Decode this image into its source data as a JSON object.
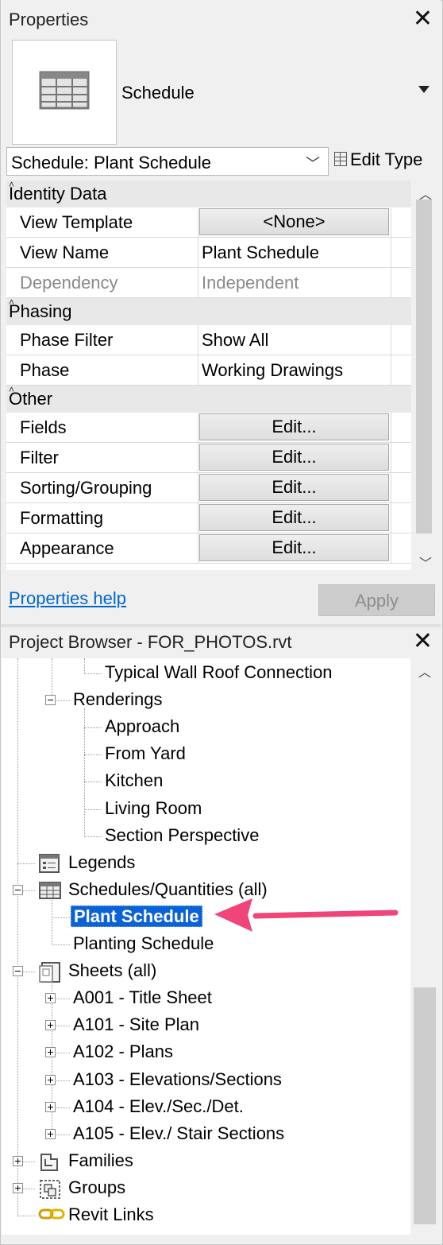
{
  "properties": {
    "title": "Properties",
    "type_name": "Schedule",
    "selector_value": "Schedule: Plant Schedule",
    "edit_type_label": "Edit Type",
    "categories": [
      {
        "name": "Identity Data",
        "rows": [
          {
            "label": "View Template",
            "value": "<None>",
            "kind": "button"
          },
          {
            "label": "View Name",
            "value": "Plant Schedule",
            "kind": "text"
          },
          {
            "label": "Dependency",
            "value": "Independent",
            "kind": "disabled"
          }
        ]
      },
      {
        "name": "Phasing",
        "rows": [
          {
            "label": "Phase Filter",
            "value": "Show All",
            "kind": "text"
          },
          {
            "label": "Phase",
            "value": "Working Drawings",
            "kind": "text"
          }
        ]
      },
      {
        "name": "Other",
        "rows": [
          {
            "label": "Fields",
            "value": "Edit...",
            "kind": "button"
          },
          {
            "label": "Filter",
            "value": "Edit...",
            "kind": "button"
          },
          {
            "label": "Sorting/Grouping",
            "value": "Edit...",
            "kind": "button"
          },
          {
            "label": "Formatting",
            "value": "Edit...",
            "kind": "button"
          },
          {
            "label": "Appearance",
            "value": "Edit...",
            "kind": "button"
          }
        ]
      }
    ],
    "help_link": "Properties help",
    "apply_label": "Apply"
  },
  "browser": {
    "title": "Project Browser - FOR_PHOTOS.rvt",
    "nodes": [
      {
        "label": "Typical Wall Roof Connection",
        "level": 3,
        "toggle": "",
        "icon": ""
      },
      {
        "label": "Renderings",
        "level": 2,
        "toggle": "minus",
        "icon": ""
      },
      {
        "label": "Approach",
        "level": 3,
        "toggle": "",
        "icon": ""
      },
      {
        "label": "From Yard",
        "level": 3,
        "toggle": "",
        "icon": ""
      },
      {
        "label": "Kitchen",
        "level": 3,
        "toggle": "",
        "icon": ""
      },
      {
        "label": "Living Room",
        "level": 3,
        "toggle": "",
        "icon": ""
      },
      {
        "label": "Section Perspective",
        "level": 3,
        "toggle": "",
        "icon": ""
      },
      {
        "label": "Legends",
        "level": 1,
        "toggle": "",
        "icon": "legend-icon"
      },
      {
        "label": "Schedules/Quantities (all)",
        "level": 1,
        "toggle": "minus",
        "icon": "schedule-icon"
      },
      {
        "label": "Plant Schedule",
        "level": 2,
        "toggle": "",
        "icon": "",
        "selected": true
      },
      {
        "label": "Planting Schedule",
        "level": 2,
        "toggle": "",
        "icon": ""
      },
      {
        "label": "Sheets (all)",
        "level": 1,
        "toggle": "minus",
        "icon": "sheets-icon"
      },
      {
        "label": "A001 - Title Sheet",
        "level": 2,
        "toggle": "plus",
        "icon": ""
      },
      {
        "label": "A101 - Site Plan",
        "level": 2,
        "toggle": "plus",
        "icon": ""
      },
      {
        "label": "A102 - Plans",
        "level": 2,
        "toggle": "plus",
        "icon": ""
      },
      {
        "label": "A103 - Elevations/Sections",
        "level": 2,
        "toggle": "plus",
        "icon": ""
      },
      {
        "label": "A104 - Elev./Sec./Det.",
        "level": 2,
        "toggle": "plus",
        "icon": ""
      },
      {
        "label": "A105 - Elev./ Stair Sections",
        "level": 2,
        "toggle": "plus",
        "icon": ""
      },
      {
        "label": "Families",
        "level": 1,
        "toggle": "plus",
        "icon": "families-icon"
      },
      {
        "label": "Groups",
        "level": 1,
        "toggle": "plus",
        "icon": "groups-icon"
      },
      {
        "label": "Revit Links",
        "level": 1,
        "toggle": "",
        "icon": "revit-links-icon"
      }
    ]
  },
  "annotation": {
    "arrow_color": "#f0457a"
  }
}
